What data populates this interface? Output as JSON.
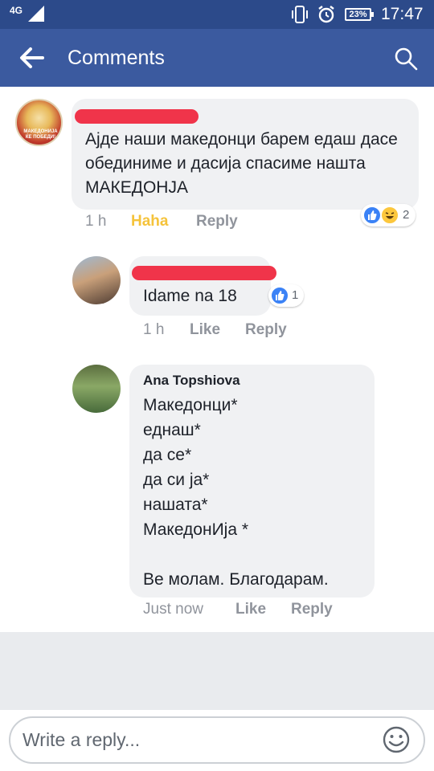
{
  "status_bar": {
    "network": "4G",
    "battery": "23%",
    "time": "17:47"
  },
  "header": {
    "title": "Comments"
  },
  "comments": [
    {
      "text": "Ајде наши македонци барем едаш дасе обединиме и дасија спасиме нашта МАКЕДОНЈА",
      "avatar_text": "МАКЕДОНИЈА ЌЕ ПОБЕДИ!",
      "time": "1 h",
      "reaction_action": "Haha",
      "reply_label": "Reply",
      "reaction_count": "2"
    },
    {
      "text": "Idame na 18",
      "time": "1 h",
      "like_label": "Like",
      "reply_label": "Reply",
      "reaction_count": "1"
    },
    {
      "author": "Ana Topshiova",
      "lines": [
        "Македонци*",
        "еднаш*",
        "да се*",
        "да си ја*",
        "нашата*",
        "МакедонИја *",
        "",
        "Ве молам. Благодарам."
      ],
      "time": "Just now",
      "like_label": "Like",
      "reply_label": "Reply"
    }
  ],
  "reply_box": {
    "placeholder": "Write a reply..."
  },
  "colors": {
    "status_bar": "#2c4a8a",
    "header": "#3b5a9f",
    "haha": "#f5c33b",
    "like": "#3b82f6",
    "redaction": "#f0344a"
  }
}
